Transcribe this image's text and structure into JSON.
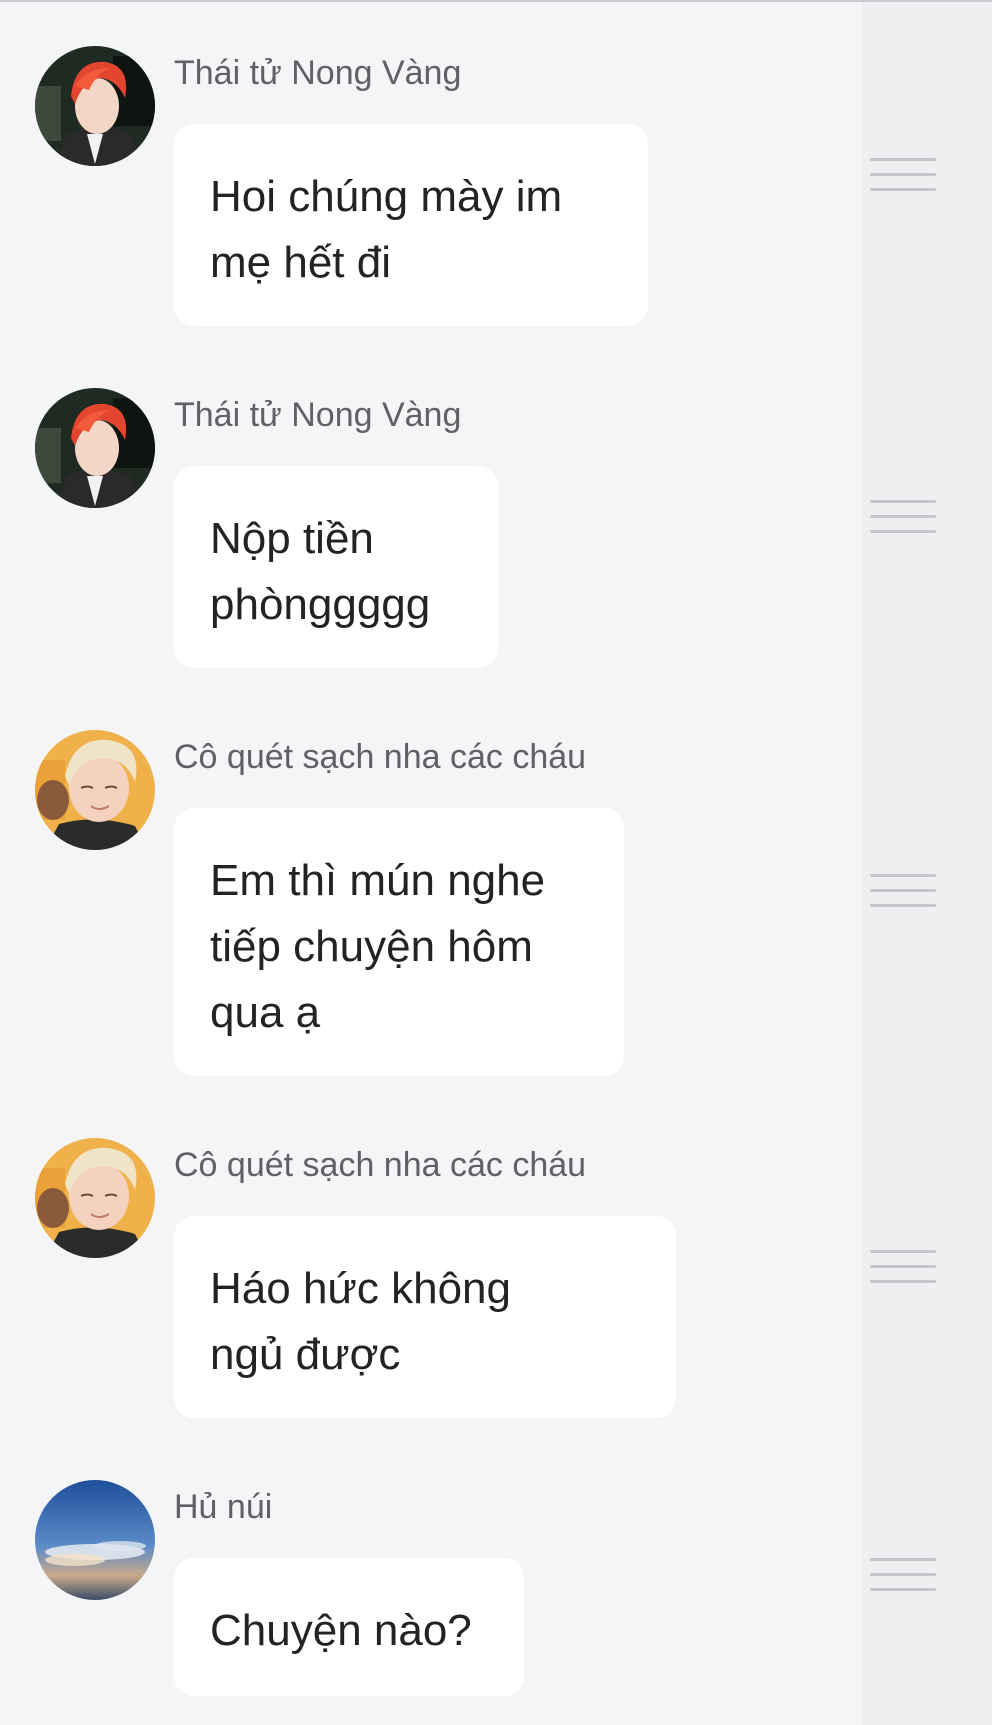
{
  "messages": [
    {
      "sender": "Thái tử Nong Vàng",
      "lines": [
        "Hoi chúng mày im",
        "mẹ hết đi"
      ],
      "avatar_icon": "avatar-red-hair-icon"
    },
    {
      "sender": "Thái tử Nong Vàng",
      "lines": [
        "Nộp tiền",
        "phònggggg"
      ],
      "avatar_icon": "avatar-red-hair-icon"
    },
    {
      "sender": "Cô quét sạch nha các cháu",
      "lines": [
        "Em thì mún nghe",
        "tiếp chuyện hôm",
        "qua ạ"
      ],
      "avatar_icon": "avatar-blonde-hair-icon"
    },
    {
      "sender": "Cô quét sạch nha các cháu",
      "lines": [
        "Háo hức không",
        "ngủ được"
      ],
      "avatar_icon": "avatar-blonde-hair-icon"
    },
    {
      "sender": "Hủ núi",
      "lines": [
        "Chuyện nào?"
      ],
      "avatar_icon": "avatar-sky-icon"
    }
  ],
  "menu_icon": "hamburger-menu-icon",
  "colors": {
    "background": "#f4f5f7",
    "bubble": "#ffffff",
    "sender_text": "#5f6166",
    "message_text": "#222326",
    "menu_lines": "#c4c6cb"
  }
}
